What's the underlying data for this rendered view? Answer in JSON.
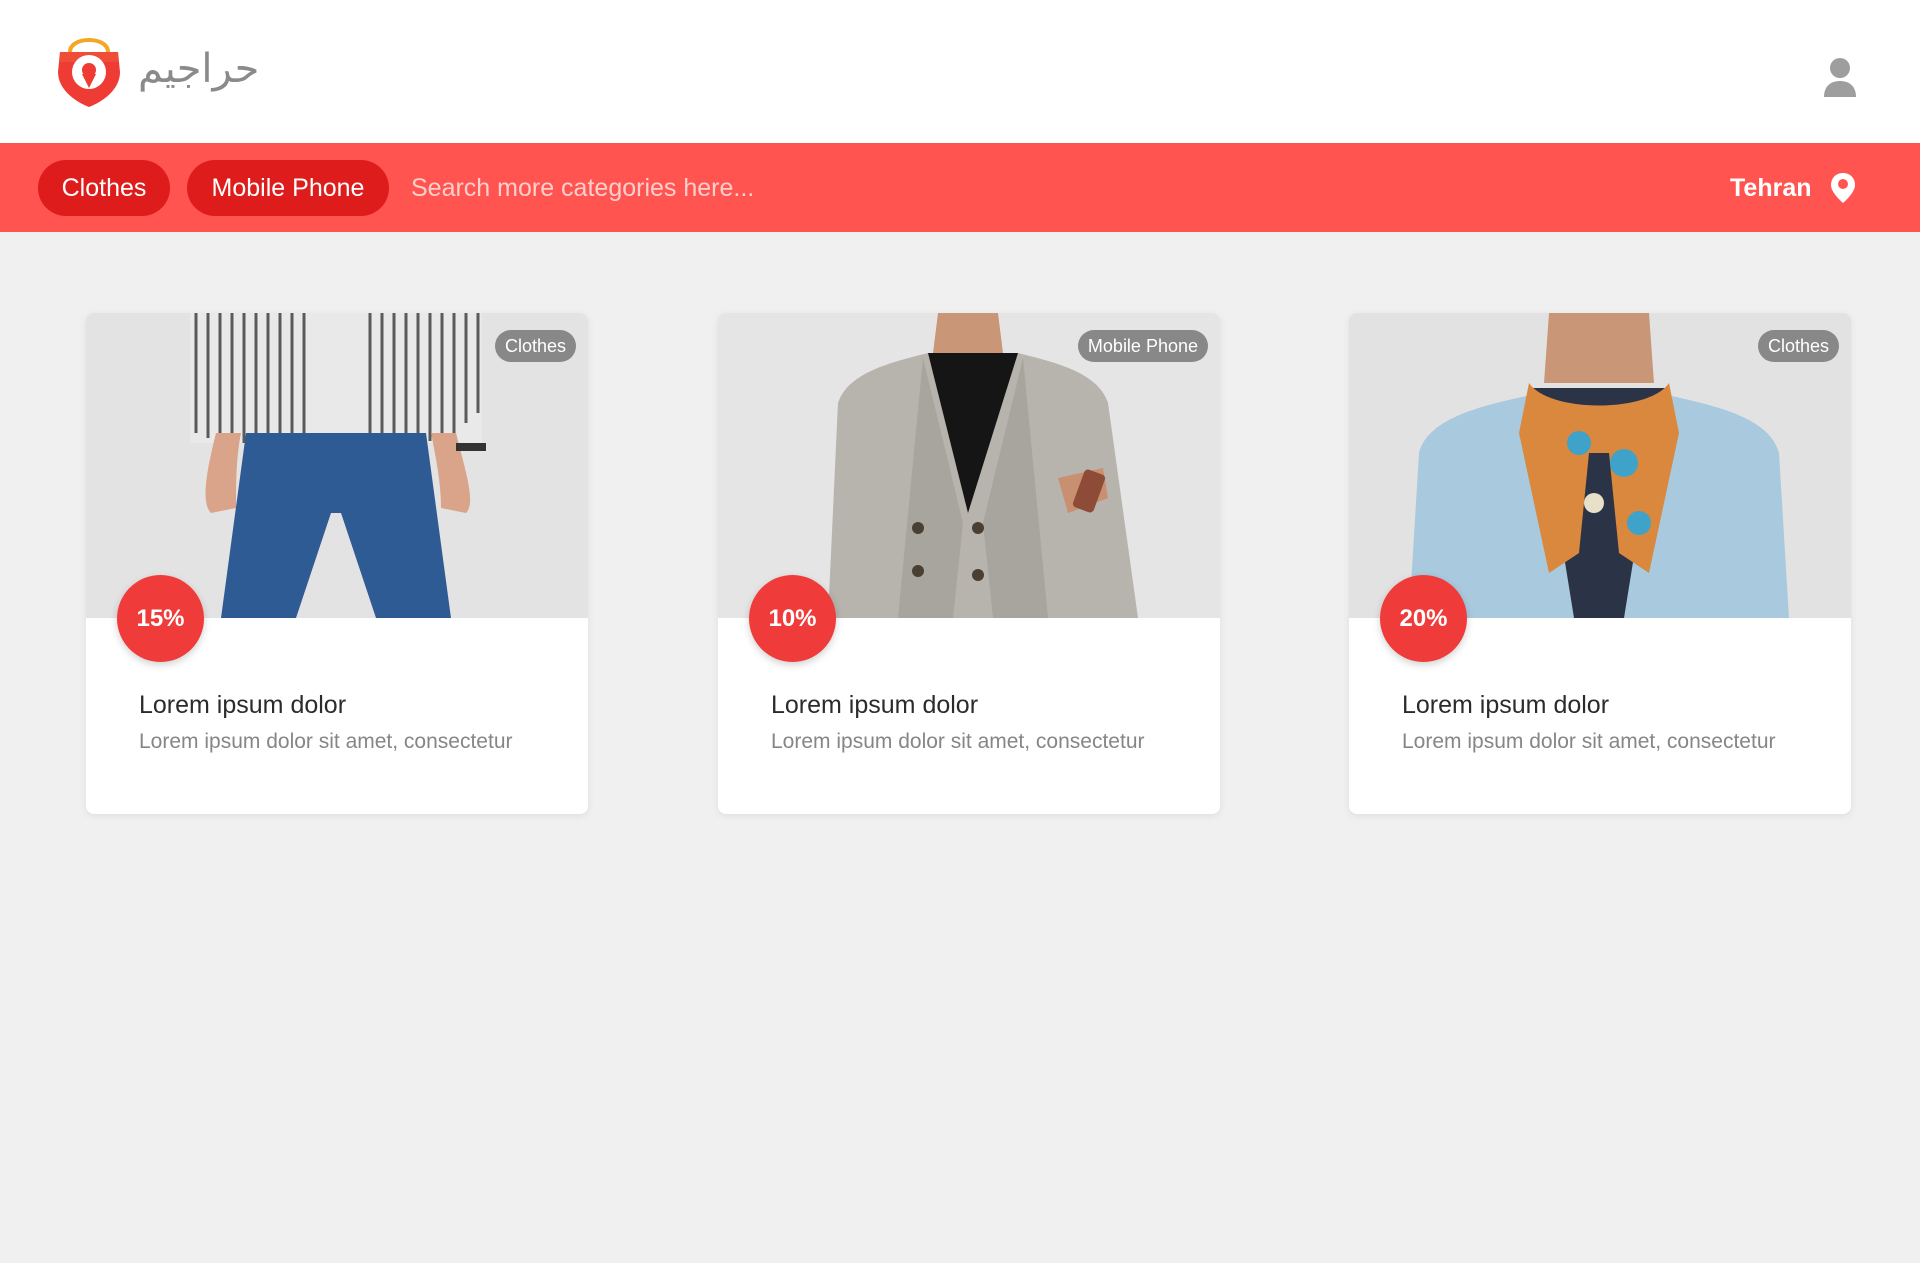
{
  "header": {
    "brand_name": "حراجیم",
    "brand_color": "#e8302b",
    "profile_icon": "user-icon"
  },
  "category_bar": {
    "background": "#ff5450",
    "chips": [
      {
        "label": "Clothes"
      },
      {
        "label": "Mobile Phone"
      }
    ],
    "search": {
      "placeholder": "Search more categories here...",
      "value": ""
    },
    "location": {
      "label": "Tehran",
      "icon": "map-pin-icon"
    }
  },
  "products": [
    {
      "category": "Clothes",
      "discount": "15%",
      "title": "Lorem ipsum dolor",
      "description": "Lorem ipsum dolor sit amet, consectetur"
    },
    {
      "category": "Mobile Phone",
      "discount": "10%",
      "title": "Lorem ipsum dolor",
      "description": "Lorem ipsum dolor sit amet, consectetur"
    },
    {
      "category": "Clothes",
      "discount": "20%",
      "title": "Lorem ipsum dolor",
      "description": "Lorem ipsum dolor sit amet, consectetur"
    }
  ],
  "colors": {
    "accent": "#ff5450",
    "chip": "#de1c1c",
    "discount_badge": "#f03b3b",
    "page_bg": "#f1f0f0"
  }
}
